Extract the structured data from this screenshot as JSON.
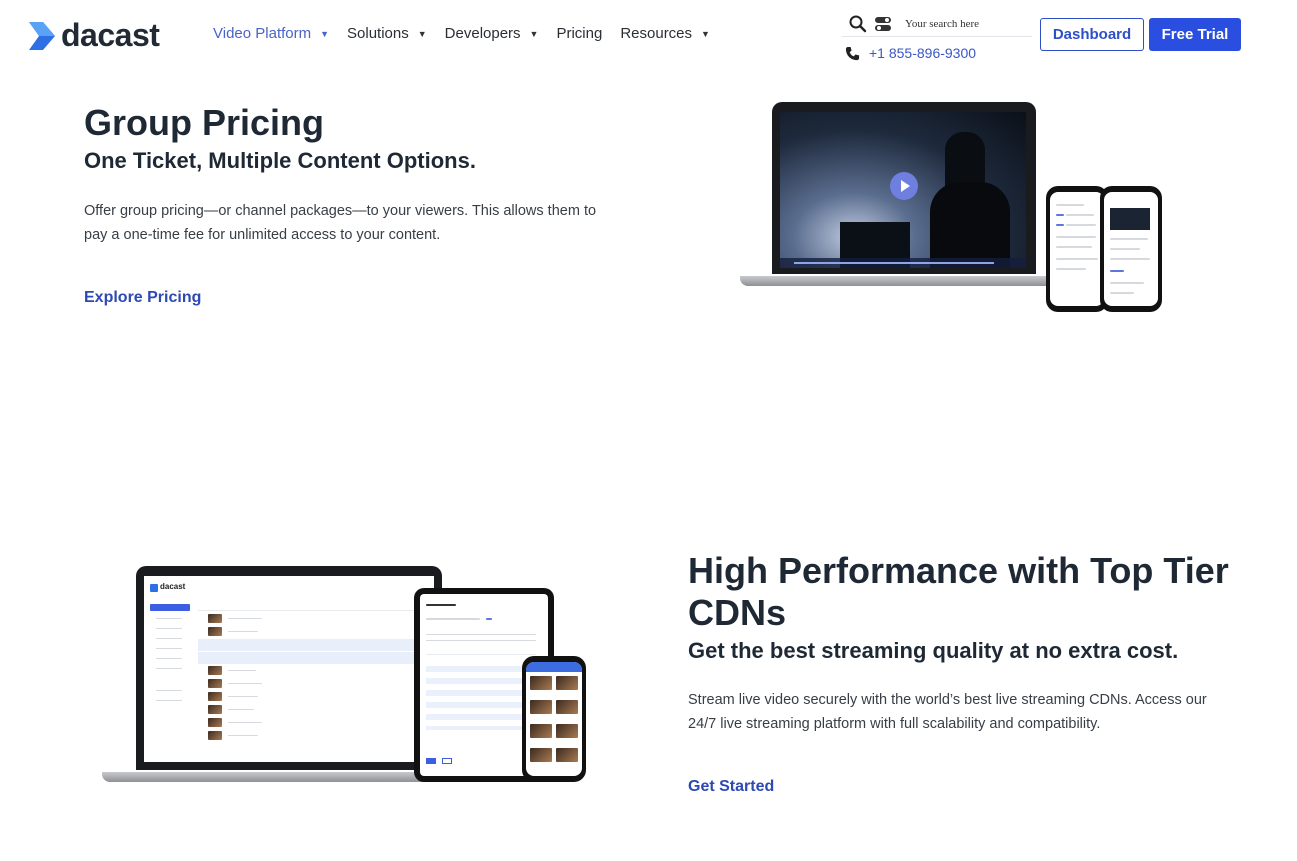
{
  "brand": {
    "name": "dacast",
    "logo_color": "#2f6fe6"
  },
  "nav": {
    "items": [
      {
        "label": "Video Platform",
        "dropdown": true,
        "active": true
      },
      {
        "label": "Solutions",
        "dropdown": true,
        "active": false
      },
      {
        "label": "Developers",
        "dropdown": true,
        "active": false
      },
      {
        "label": "Pricing",
        "dropdown": false,
        "active": false
      },
      {
        "label": "Resources",
        "dropdown": true,
        "active": false
      }
    ]
  },
  "search": {
    "placeholder": "Your search here",
    "icon": "search-icon",
    "toggle_icon": "toggle-icon"
  },
  "contact": {
    "phone": "+1 855-896-9300",
    "icon": "phone-icon"
  },
  "buttons": {
    "dashboard": "Dashboard",
    "free_trial": "Free Trial"
  },
  "colors": {
    "accent": "#2a4fe0",
    "link": "#2d49b4",
    "text": "#1e2935"
  },
  "section_group_pricing": {
    "title": "Group Pricing",
    "subtitle": "One Ticket, Multiple Content Options.",
    "body": "Offer group pricing—or channel packages—to your viewers. This allows them to pay a one-time fee for unlimited access to your content.",
    "cta": "Explore Pricing"
  },
  "section_cdn": {
    "title": "High Performance with Top Tier CDNs",
    "subtitle": "Get the best streaming quality at no extra cost.",
    "body": "Stream live video securely with the world’s best live streaming CDNs. Access our 24/7 live streaming platform with full scalability and compatibility.",
    "cta": "Get Started"
  },
  "mockup_dashboard": {
    "brand": "dacast"
  }
}
